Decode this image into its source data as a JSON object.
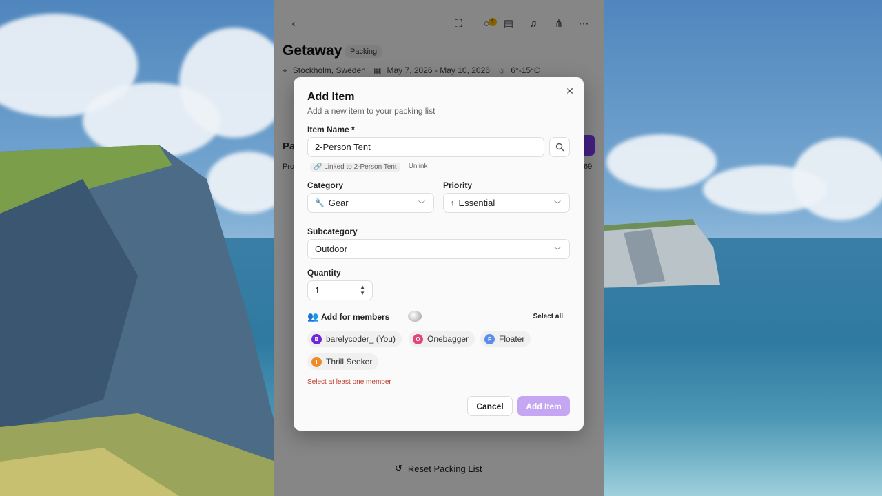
{
  "app": {
    "trip_title": "Getaway",
    "trip_status_badge": "Packing",
    "location": "Stockholm, Sweden",
    "dates": "May 7, 2026 - May 10, 2026",
    "temperature": "6°-15°C",
    "notification_count": "1",
    "reset_label": "Reset Packing List",
    "fragment_section": "Pa",
    "fragment_pro": "Pro",
    "fragment_count": "69"
  },
  "modal": {
    "title": "Add Item",
    "subtitle": "Add a new item to your packing list",
    "item_name_label": "Item Name *",
    "item_name_value": "2-Person Tent",
    "linked_text": "Linked to 2-Person Tent",
    "unlink_label": "Unlink",
    "category_label": "Category",
    "category_value": "Gear",
    "priority_label": "Priority",
    "priority_value": "Essential",
    "subcategory_label": "Subcategory",
    "subcategory_value": "Outdoor",
    "quantity_label": "Quantity",
    "quantity_value": "1",
    "members_label": "Add for members",
    "select_all_label": "Select all",
    "members": [
      {
        "initial": "B",
        "name": "barelycoder_ (You)",
        "color": "#6d28d9"
      },
      {
        "initial": "O",
        "name": "Onebagger",
        "color": "#e0457b"
      },
      {
        "initial": "F",
        "name": "Floater",
        "color": "#5b8def"
      },
      {
        "initial": "T",
        "name": "Thrill Seeker",
        "color": "#f08a24"
      }
    ],
    "error_text": "Select at least one member",
    "cancel_label": "Cancel",
    "add_label": "Add Item"
  }
}
